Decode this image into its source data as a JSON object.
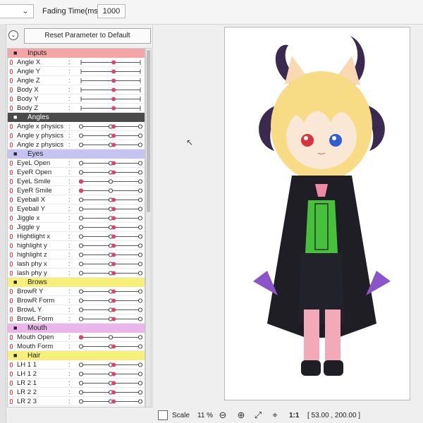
{
  "toolbar": {
    "fading_label": "Fading Time(ms):",
    "fading_value": "1000",
    "dropdown_chevron": "chevron-down-icon"
  },
  "reset_button": "Reset Parameter to Default",
  "groups": [
    {
      "name": "Inputs",
      "color": "#f4a6a6",
      "params": [
        {
          "name": "Angle X",
          "value": 0.55,
          "style": "line"
        },
        {
          "name": "Angle Y",
          "value": 0.55,
          "style": "line"
        },
        {
          "name": "Angle Z",
          "value": 0.55,
          "style": "line"
        },
        {
          "name": "Body X",
          "value": 0.55,
          "style": "line"
        },
        {
          "name": "Body Y",
          "value": 0.55,
          "style": "line"
        },
        {
          "name": "Body Z",
          "value": 0.55,
          "style": "line"
        }
      ]
    },
    {
      "name": "Angles",
      "color": "#4a4a4a",
      "text_color": "#ffffff",
      "params": [
        {
          "name": "Angle x physics",
          "value": 0.55,
          "style": "dots"
        },
        {
          "name": "Angle y physics",
          "value": 0.55,
          "style": "dots"
        },
        {
          "name": "Angle z physics",
          "value": 0.55,
          "style": "dots"
        }
      ]
    },
    {
      "name": "Eyes",
      "color": "#c6c2f2",
      "params": [
        {
          "name": "EyeL Open",
          "value": 0.55,
          "style": "dots"
        },
        {
          "name": "EyeR Open",
          "value": 0.55,
          "style": "dots"
        },
        {
          "name": "EyeL Smile",
          "value": 0.0,
          "style": "dots"
        },
        {
          "name": "EyeR Smile",
          "value": 0.0,
          "style": "dots"
        },
        {
          "name": "Eyeball X",
          "value": 0.55,
          "style": "dots"
        },
        {
          "name": "Eyeball Y",
          "value": 0.55,
          "style": "dots"
        },
        {
          "name": "Jiggle x",
          "value": 0.55,
          "style": "dots"
        },
        {
          "name": "Jiggle y",
          "value": 0.55,
          "style": "dots"
        },
        {
          "name": "Hightlight x",
          "value": 0.55,
          "style": "dots"
        },
        {
          "name": "highlight y",
          "value": 0.55,
          "style": "dots"
        },
        {
          "name": "highlight z",
          "value": 0.55,
          "style": "dots"
        },
        {
          "name": "lash phy x",
          "value": 0.55,
          "style": "dots"
        },
        {
          "name": "lash phy y",
          "value": 0.55,
          "style": "dots"
        }
      ]
    },
    {
      "name": "Brows",
      "color": "#f6f07a",
      "params": [
        {
          "name": "BrowR Y",
          "value": 0.55,
          "style": "dots"
        },
        {
          "name": "BrowR Form",
          "value": 0.55,
          "style": "dots"
        },
        {
          "name": "BrowL Y",
          "value": 0.55,
          "style": "dots"
        },
        {
          "name": "BrowL Form",
          "value": 0.55,
          "style": "dots"
        }
      ]
    },
    {
      "name": "Mouth",
      "color": "#e9b5ea",
      "params": [
        {
          "name": "Mouth Open",
          "value": 0.0,
          "style": "dots"
        },
        {
          "name": "Mouth Form",
          "value": 0.55,
          "style": "dots"
        }
      ]
    },
    {
      "name": "Hair",
      "color": "#f6f07a",
      "params": [
        {
          "name": "LH 1 1",
          "value": 0.55,
          "style": "dots"
        },
        {
          "name": "LH 1 2",
          "value": 0.55,
          "style": "dots"
        },
        {
          "name": "LR 2 1",
          "value": 0.55,
          "style": "dots"
        },
        {
          "name": "LR 2 2",
          "value": 0.55,
          "style": "dots"
        },
        {
          "name": "LR 2 3",
          "value": 0.55,
          "style": "dots"
        }
      ]
    }
  ],
  "statusbar": {
    "scale_label": "Scale",
    "zoom": "11 %",
    "scale_ratio": "1:1",
    "coords": "[   53.00 , 200.00 ]"
  },
  "colors": {
    "knob": "#e0436b",
    "accent_line": "#555555"
  }
}
